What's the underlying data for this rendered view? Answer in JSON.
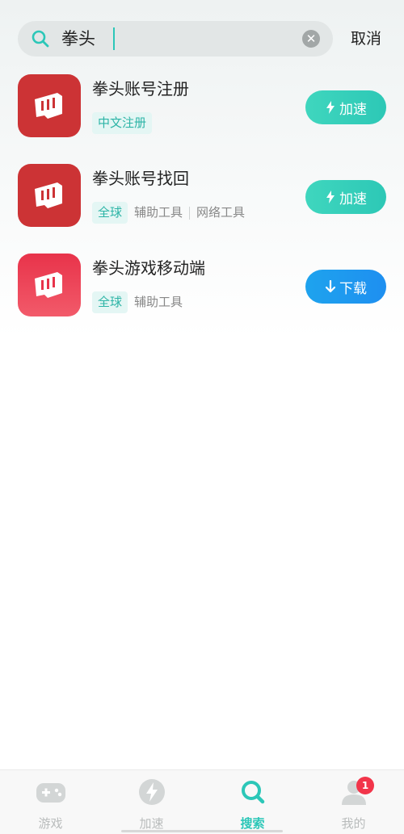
{
  "search": {
    "query": "拳头",
    "cancel_label": "取消"
  },
  "results": [
    {
      "title": "拳头账号注册",
      "tags": [
        {
          "text": "中文注册",
          "style": "pill"
        }
      ],
      "action": {
        "label": "加速",
        "type": "accelerate"
      },
      "icon": "riot-fist-icon"
    },
    {
      "title": "拳头账号找回",
      "tags": [
        {
          "text": "全球",
          "style": "pill"
        },
        {
          "text": "辅助工具",
          "style": "plain"
        },
        {
          "text": "网络工具",
          "style": "plain"
        }
      ],
      "action": {
        "label": "加速",
        "type": "accelerate"
      },
      "icon": "riot-fist-icon"
    },
    {
      "title": "拳头游戏移动端",
      "tags": [
        {
          "text": "全球",
          "style": "pill"
        },
        {
          "text": "辅助工具",
          "style": "plain"
        }
      ],
      "action": {
        "label": "下载",
        "type": "download"
      },
      "icon": "riot-fist-icon"
    }
  ],
  "bottom_nav": {
    "items": [
      {
        "label": "游戏",
        "icon": "gamepad-icon",
        "active": false
      },
      {
        "label": "加速",
        "icon": "lightning-icon",
        "active": false
      },
      {
        "label": "搜索",
        "icon": "search-icon",
        "active": true
      },
      {
        "label": "我的",
        "icon": "user-icon",
        "active": false
      }
    ],
    "profile_badge": "1"
  },
  "colors": {
    "accent": "#2cc7b8",
    "accelerate_button": "#35cfba",
    "download_button": "#1e98ef",
    "badge": "#f2354a"
  }
}
